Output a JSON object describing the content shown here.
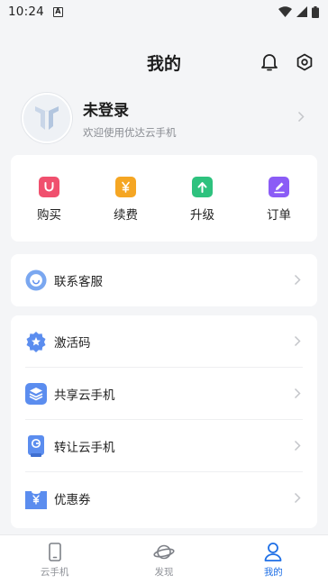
{
  "status_bar": {
    "time": "10:24",
    "badge": "A"
  },
  "header": {
    "title": "我的",
    "icons": [
      "bell-icon",
      "settings-icon"
    ]
  },
  "profile": {
    "name": "未登录",
    "subtitle": "欢迎使用优达云手机"
  },
  "quick_actions": [
    {
      "label": "购买",
      "icon": "shop-bag-icon",
      "color": "#f0506e"
    },
    {
      "label": "续费",
      "icon": "yen-icon",
      "color": "#f5a623"
    },
    {
      "label": "升级",
      "icon": "upgrade-arrow-icon",
      "color": "#2ec27e"
    },
    {
      "label": "订单",
      "icon": "order-edit-icon",
      "color": "#8b5cf6"
    }
  ],
  "support": {
    "label": "联系客服",
    "icon": "customer-service-icon"
  },
  "menu": [
    {
      "label": "激活码",
      "icon": "badge-star-icon"
    },
    {
      "label": "共享云手机",
      "icon": "layers-icon"
    },
    {
      "label": "转让云手机",
      "icon": "transfer-device-icon"
    },
    {
      "label": "优惠券",
      "icon": "coupon-icon"
    }
  ],
  "bottom_nav": [
    {
      "label": "云手机",
      "icon": "phone-icon",
      "active": false
    },
    {
      "label": "发现",
      "icon": "planet-icon",
      "active": false
    },
    {
      "label": "我的",
      "icon": "user-icon",
      "active": true
    }
  ],
  "colors": {
    "accent": "#1e6fe6",
    "icon_blue": "#5b8def"
  }
}
